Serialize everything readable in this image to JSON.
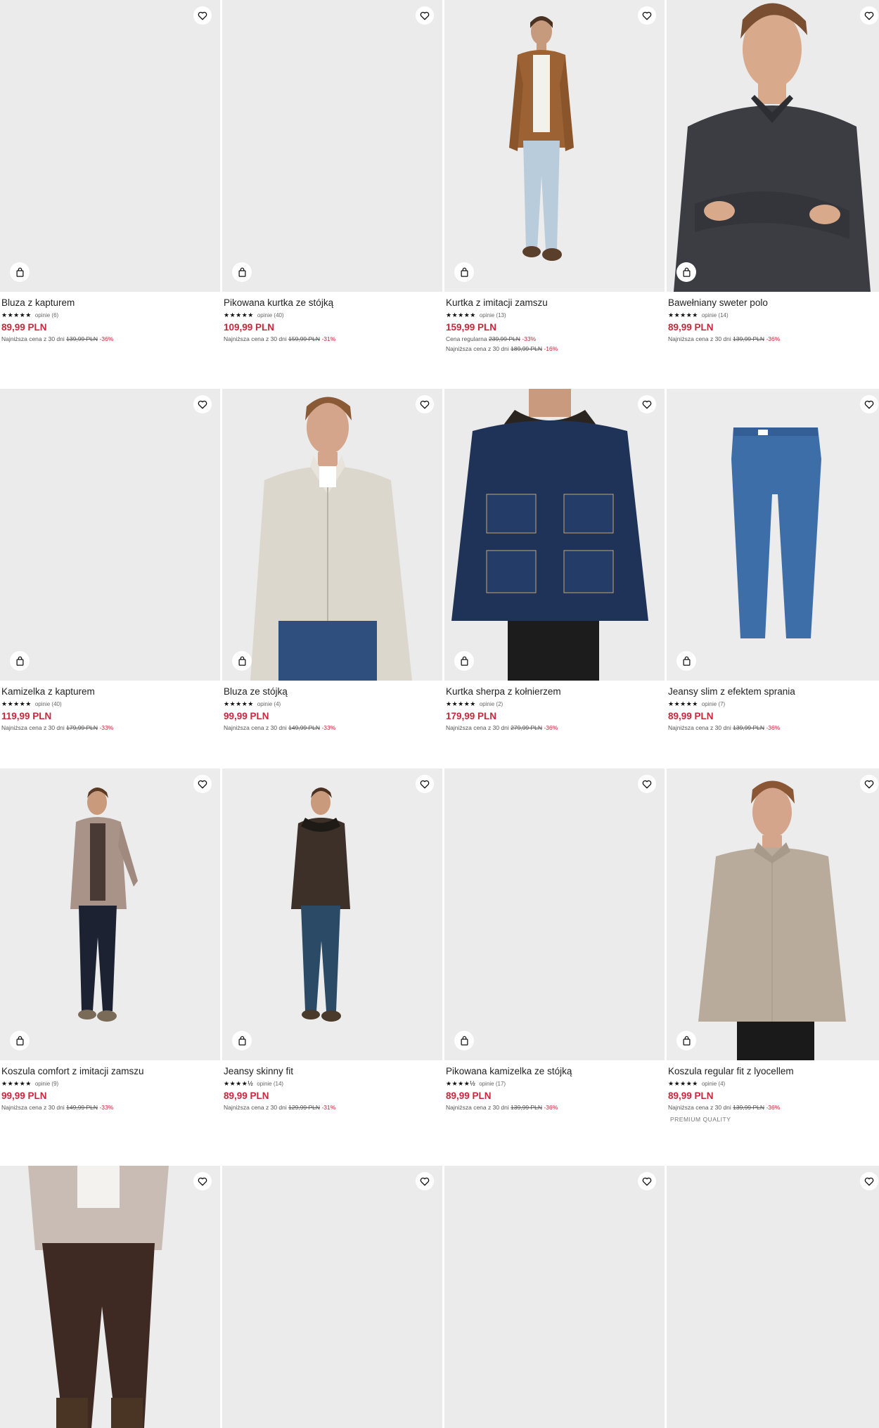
{
  "products": [
    {
      "name": "Bluza z kapturem",
      "stars": "★★★★★",
      "reviews": "opinie (6)",
      "price": "89,99 PLN",
      "lines": [
        {
          "label": "Najniższa cena z 30 dni",
          "old": "139,99 PLN",
          "pct": "-36%"
        }
      ]
    },
    {
      "name": "Pikowana kurtka ze stójką",
      "stars": "★★★★★",
      "reviews": "opinie (40)",
      "price": "109,99 PLN",
      "lines": [
        {
          "label": "Najniższa cena z 30 dni",
          "old": "159,99 PLN",
          "pct": "-31%"
        }
      ]
    },
    {
      "name": "Kurtka z imitacji zamszu",
      "stars": "★★★★★",
      "reviews": "opinie (13)",
      "price": "159,99 PLN",
      "lines": [
        {
          "label": "Cena regularna",
          "old": "239,99 PLN",
          "pct": "-33%"
        },
        {
          "label": "Najniższa cena z 30 dni",
          "old": "189,99 PLN",
          "pct": "-16%"
        }
      ]
    },
    {
      "name": "Bawełniany sweter polo",
      "stars": "★★★★★",
      "reviews": "opinie (14)",
      "price": "89,99 PLN",
      "lines": [
        {
          "label": "Najniższa cena z 30 dni",
          "old": "139,99 PLN",
          "pct": "-36%"
        }
      ]
    },
    {
      "name": "Kamizelka z kapturem",
      "stars": "★★★★★",
      "reviews": "opinie (40)",
      "price": "119,99 PLN",
      "lines": [
        {
          "label": "Najniższa cena z 30 dni",
          "old": "179,99 PLN",
          "pct": "-33%"
        }
      ]
    },
    {
      "name": "Bluza ze stójką",
      "stars": "★★★★★",
      "reviews": "opinie (4)",
      "price": "99,99 PLN",
      "lines": [
        {
          "label": "Najniższa cena z 30 dni",
          "old": "149,99 PLN",
          "pct": "-33%"
        }
      ]
    },
    {
      "name": "Kurtka sherpa z kołnierzem",
      "stars": "★★★★★",
      "reviews": "opinie (2)",
      "price": "179,99 PLN",
      "lines": [
        {
          "label": "Najniższa cena z 30 dni",
          "old": "279,99 PLN",
          "pct": "-36%"
        }
      ]
    },
    {
      "name": "Jeansy slim z efektem sprania",
      "stars": "★★★★★",
      "reviews": "opinie (7)",
      "price": "89,99 PLN",
      "lines": [
        {
          "label": "Najniższa cena z 30 dni",
          "old": "139,99 PLN",
          "pct": "-36%"
        }
      ]
    },
    {
      "name": "Koszula comfort z imitacji zamszu",
      "stars": "★★★★★",
      "reviews": "opinie (9)",
      "price": "99,99 PLN",
      "lines": [
        {
          "label": "Najniższa cena z 30 dni",
          "old": "149,99 PLN",
          "pct": "-33%"
        }
      ]
    },
    {
      "name": "Jeansy skinny fit",
      "stars": "★★★★½",
      "reviews": "opinie (14)",
      "price": "89,99 PLN",
      "lines": [
        {
          "label": "Najniższa cena z 30 dni",
          "old": "129,99 PLN",
          "pct": "-31%"
        }
      ]
    },
    {
      "name": "Pikowana kamizelka ze stójką",
      "stars": "★★★★½",
      "reviews": "opinie (17)",
      "price": "89,99 PLN",
      "lines": [
        {
          "label": "Najniższa cena z 30 dni",
          "old": "139,99 PLN",
          "pct": "-36%"
        }
      ]
    },
    {
      "name": "Koszula regular fit z lyocellem",
      "stars": "★★★★★",
      "reviews": "opinie (4)",
      "price": "89,99 PLN",
      "lines": [
        {
          "label": "Najniższa cena z 30 dni",
          "old": "139,99 PLN",
          "pct": "-36%"
        }
      ],
      "badge": "PREMIUM QUALITY"
    }
  ],
  "icons": {
    "wishlist": "heart-icon",
    "add_to_bag": "shopping-bag-icon"
  },
  "colors": {
    "price": "#c8283c",
    "image_bg": "#ebebeb"
  }
}
